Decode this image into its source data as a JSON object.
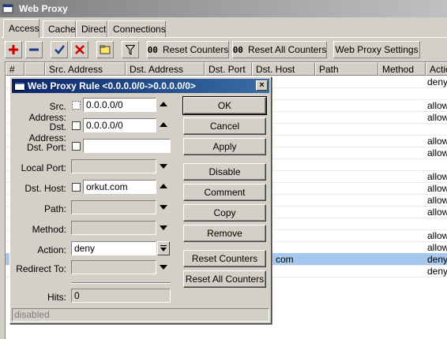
{
  "window": {
    "title": "Web Proxy"
  },
  "tabs": [
    "Access",
    "Cache",
    "Direct",
    "Connections"
  ],
  "toolbar": {
    "reset_counters": "Reset Counters",
    "reset_all_counters": "Reset All Counters",
    "web_proxy_settings": "Web Proxy Settings",
    "counter_glyph": "00"
  },
  "table": {
    "headers": [
      "#",
      "",
      "Src. Address",
      "Dst. Address",
      "Dst. Port",
      "Dst. Host",
      "Path",
      "Method",
      "Actio"
    ],
    "rows": [
      {
        "host": "",
        "action": "deny"
      },
      {
        "host": "",
        "action": ""
      },
      {
        "host": "",
        "action": "allow"
      },
      {
        "host": "",
        "action": "allow"
      },
      {
        "host": "",
        "action": ""
      },
      {
        "host": "",
        "action": "allow"
      },
      {
        "host": "",
        "action": "allow"
      },
      {
        "host": "",
        "action": ""
      },
      {
        "host": "",
        "action": "allow"
      },
      {
        "host": "",
        "action": "allow"
      },
      {
        "host": "",
        "action": "allow"
      },
      {
        "host": "",
        "action": "allow"
      },
      {
        "host": "",
        "action": ""
      },
      {
        "host": "",
        "action": "allow"
      },
      {
        "host": "",
        "action": "allow"
      },
      {
        "host": "com",
        "action": "deny"
      },
      {
        "host": "",
        "action": "deny"
      }
    ]
  },
  "dialog": {
    "title": "Web Proxy Rule <0.0.0.0/0->0.0.0.0/0>",
    "fields": {
      "src_address": {
        "label": "Src. Address:",
        "value": "0.0.0.0/0"
      },
      "dst_address": {
        "label": "Dst. Address:",
        "value": "0.0.0.0/0"
      },
      "dst_port": {
        "label": "Dst. Port:",
        "value": ""
      },
      "local_port": {
        "label": "Local Port:",
        "value": ""
      },
      "dst_host": {
        "label": "Dst. Host:",
        "value": "orkut.com"
      },
      "path": {
        "label": "Path:",
        "value": ""
      },
      "method": {
        "label": "Method:",
        "value": ""
      },
      "action": {
        "label": "Action:",
        "value": "deny"
      },
      "redirect_to": {
        "label": "Redirect To:",
        "value": ""
      },
      "hits": {
        "label": "Hits:",
        "value": "0"
      }
    },
    "buttons": {
      "ok": "OK",
      "cancel": "Cancel",
      "apply": "Apply",
      "disable": "Disable",
      "comment": "Comment",
      "copy": "Copy",
      "remove": "Remove",
      "reset_counters": "Reset Counters",
      "reset_all_counters": "Reset All Counters"
    },
    "status": "disabled"
  }
}
